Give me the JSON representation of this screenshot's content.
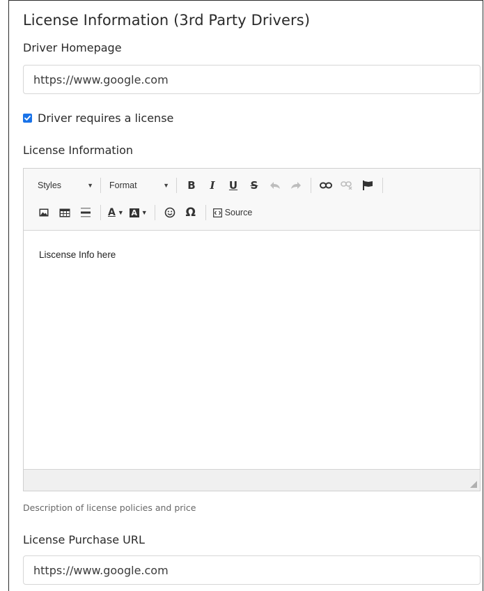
{
  "section": {
    "title": "License Information (3rd Party Drivers)"
  },
  "homepage": {
    "label": "Driver Homepage",
    "value": "https://www.google.com"
  },
  "license_required": {
    "label": "Driver requires a license",
    "checked": true
  },
  "license_info": {
    "label": "License Information",
    "editor": {
      "styles_label": "Styles",
      "format_label": "Format",
      "source_label": "Source",
      "content": "Liscense Info here"
    },
    "help": "Description of license policies and price"
  },
  "purchase": {
    "label": "License Purchase URL",
    "value": "https://www.google.com"
  },
  "icons": {
    "bold": "bold-icon",
    "italic": "italic-icon",
    "underline": "underline-icon",
    "strike": "strikethrough-icon",
    "undo": "undo-icon",
    "redo": "redo-icon",
    "link": "link-icon",
    "unlink": "unlink-icon",
    "anchor": "flag-icon",
    "image": "image-icon",
    "table": "table-icon",
    "hr": "horizontal-line-icon",
    "text_color": "text-color-icon",
    "bg_color": "background-color-icon",
    "smiley": "smiley-icon",
    "special_char": "omega-icon",
    "source": "source-icon"
  },
  "colors": {
    "accent": "#1a73e8",
    "border": "#d6d6d6"
  }
}
